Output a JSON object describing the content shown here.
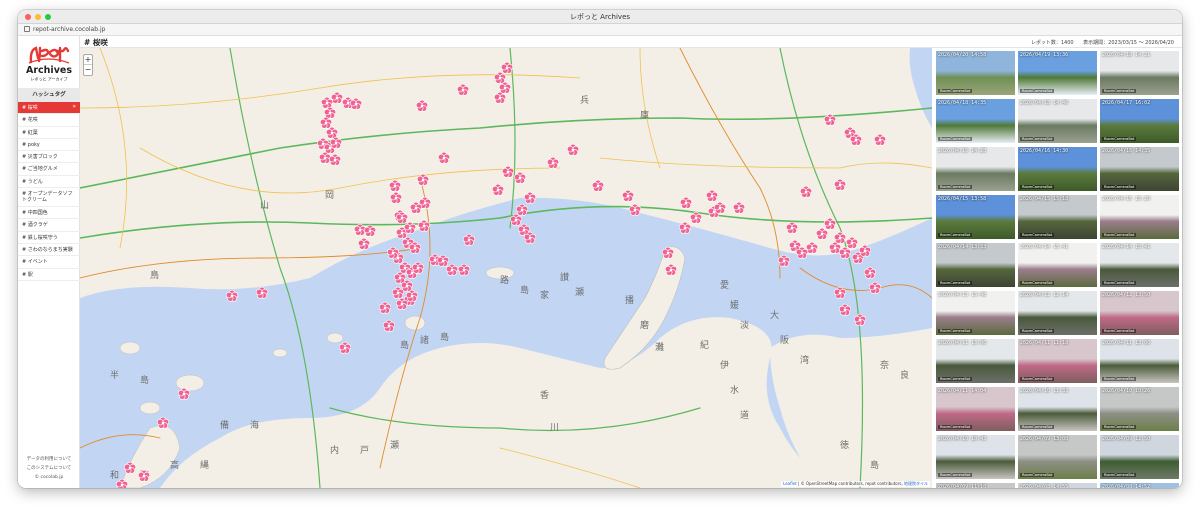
{
  "window": {
    "title": "レポっと Archives",
    "url": "repot-archive.cocolab.jp"
  },
  "logo": {
    "top": "レポット",
    "main": "Archives",
    "sub": "レポっと アーカイブ"
  },
  "sidebar": {
    "heading": "ハッシュタグ",
    "tags": [
      "桜咲",
      "花咲",
      "紅葉",
      "poky",
      "災害ブロック",
      "ご当地グルメ",
      "うどん",
      "オープンデータソフトクリーム",
      "中四国色",
      "酒クラゲ",
      "鉄し桜咲守う",
      "さわのならまち実験",
      "イベント",
      "駅"
    ],
    "footer": [
      "データの利用について",
      "このシステムについて",
      "© cocolab.jp"
    ]
  },
  "header": {
    "title": "# 桜咲",
    "count_label": "レポット数：1400",
    "period_label": "表示期間：2023/03/15 〜 2026/04/20"
  },
  "map": {
    "zoom_in": "+",
    "zoom_out": "−",
    "attribution_leaflet": "Leaflet",
    "attribution_rest": "| © OpenStreetMap contributors, repot contributors,",
    "attribution_gsi": "地理院タイル",
    "marker_color": "#f06292",
    "sea_color": "#c2d6f4",
    "land_color": "#f3efe6",
    "labels": [
      "兵",
      "庫",
      "山",
      "岡",
      "鳥",
      "香",
      "川",
      "播",
      "磨",
      "灘",
      "大",
      "阪",
      "湾",
      "瀬",
      "戸",
      "内",
      "海",
      "備",
      "讃",
      "瀬",
      "紀",
      "伊",
      "水",
      "道",
      "徳",
      "島",
      "和",
      "歌",
      "高",
      "縄",
      "半",
      "島",
      "愛",
      "媛",
      "淡",
      "路",
      "島",
      "家",
      "島",
      "諸",
      "島",
      "奈",
      "良"
    ]
  },
  "gallery": {
    "user_label": "RoomCameraBot",
    "timestamps": [
      "2026/04/20 14:58",
      "2026/04/19 13:36",
      "2026/04/18 14:21",
      "2026/04/18 14:35",
      "2026/04/18 14:46",
      "2026/04/17 16:02",
      "2026/04/16 14:28",
      "2026/04/16 14:30",
      "2026/04/16 14:35",
      "2026/04/15 13:58",
      "2026/04/15 15:18",
      "2026/04/15 15:20",
      "2026/04/14 13:33",
      "2026/04/14 15:41",
      "2026/04/14 15:41",
      "2026/04/13 13:48",
      "2026/04/12 12:14",
      "2026/04/12 13:50",
      "2026/04/11 13:06",
      "2026/04/11 11:18",
      "2026/04/11 13:06",
      "2026/04/11 14:04",
      "2026/04/10 11:33",
      "2026/04/10 10:26",
      "2026/04/10 10:43",
      "2026/04/09 13:08",
      "2026/04/09 12:50",
      "2026/04/09 11:10",
      "2026/04/08 14:55",
      "2026/04/08 14:52"
    ]
  }
}
